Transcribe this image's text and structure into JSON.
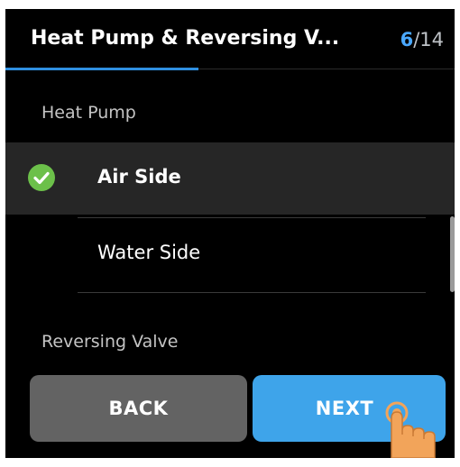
{
  "header": {
    "title": "Heat Pump & Reversing V...",
    "step_current": "6",
    "step_total": "/14",
    "progress": 0.43
  },
  "sections": [
    {
      "label": "Heat Pump",
      "options": [
        {
          "label": "Air Side",
          "selected": true
        },
        {
          "label": "Water Side",
          "selected": false
        }
      ]
    },
    {
      "label": "Reversing Valve"
    }
  ],
  "buttons": {
    "back": "BACK",
    "next": "NEXT"
  },
  "icons": {
    "check": "check-circle-icon",
    "hand": "tap-hand-icon"
  },
  "colors": {
    "accent": "#3ea4ea",
    "check": "#6cc04a",
    "background": "#000000",
    "hand": "#f2a45a"
  }
}
